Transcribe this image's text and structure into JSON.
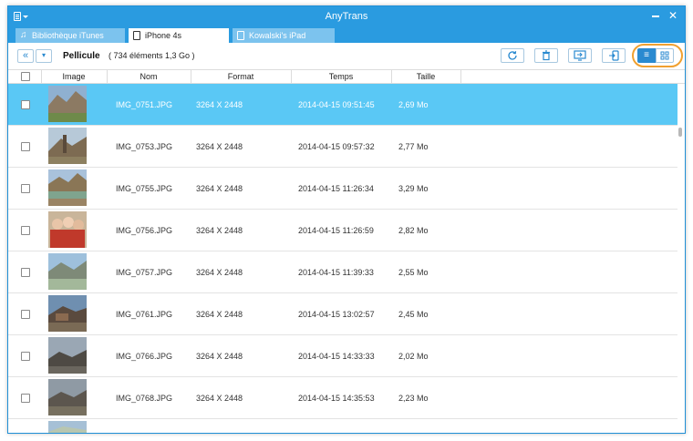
{
  "window": {
    "title": "AnyTrans"
  },
  "tabs": [
    {
      "label": "Bibliothèque iTunes",
      "icon": "music-note-icon",
      "active": false
    },
    {
      "label": "iPhone 4s",
      "icon": "iphone-icon",
      "active": true
    },
    {
      "label": "Kowalski's iPad",
      "icon": "ipad-icon",
      "active": false
    }
  ],
  "toolbar": {
    "breadcrumb": "Pellicule",
    "count": "( 734 éléments 1,3 Go )",
    "buttons": [
      "refresh-icon",
      "trash-icon",
      "send-to-computer-icon",
      "send-to-device-icon"
    ],
    "view_modes": [
      "list-view-icon",
      "grid-view-icon"
    ],
    "active_view": "list"
  },
  "table": {
    "columns": {
      "image": "Image",
      "name": "Nom",
      "format": "Format",
      "time": "Temps",
      "size": "Taille"
    },
    "rows": [
      {
        "name": "IMG_0751.JPG",
        "format": "3264 X 2448",
        "time": "2014-04-15 09:51:45",
        "size": "2,69 Mo",
        "selected": true
      },
      {
        "name": "IMG_0753.JPG",
        "format": "3264 X 2448",
        "time": "2014-04-15 09:57:32",
        "size": "2,77 Mo",
        "selected": false
      },
      {
        "name": "IMG_0755.JPG",
        "format": "3264 X 2448",
        "time": "2014-04-15 11:26:34",
        "size": "3,29 Mo",
        "selected": false
      },
      {
        "name": "IMG_0756.JPG",
        "format": "3264 X 2448",
        "time": "2014-04-15 11:26:59",
        "size": "2,82 Mo",
        "selected": false
      },
      {
        "name": "IMG_0757.JPG",
        "format": "3264 X 2448",
        "time": "2014-04-15 11:39:33",
        "size": "2,55 Mo",
        "selected": false
      },
      {
        "name": "IMG_0761.JPG",
        "format": "3264 X 2448",
        "time": "2014-04-15 13:02:57",
        "size": "2,45 Mo",
        "selected": false
      },
      {
        "name": "IMG_0766.JPG",
        "format": "3264 X 2448",
        "time": "2014-04-15 14:33:33",
        "size": "2,02 Mo",
        "selected": false
      },
      {
        "name": "IMG_0768.JPG",
        "format": "3264 X 2448",
        "time": "2014-04-15 14:35:53",
        "size": "2,23 Mo",
        "selected": false
      },
      {
        "name": "",
        "format": "",
        "time": "",
        "size": "",
        "selected": false
      }
    ]
  },
  "colors": {
    "accent": "#2a9be0",
    "selected_row": "#5ac8f5",
    "highlight_ring": "#f0a030"
  }
}
